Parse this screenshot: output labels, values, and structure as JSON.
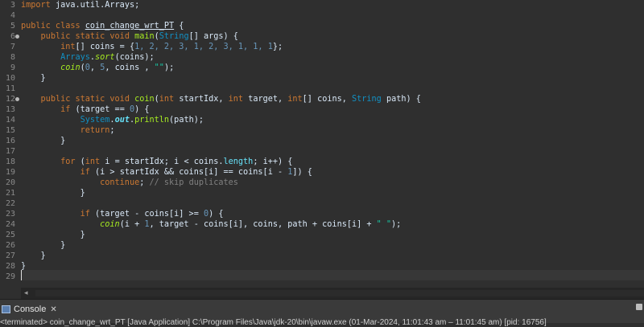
{
  "editor": {
    "line_numbers": [
      "3",
      "4",
      "5",
      "6",
      "7",
      "8",
      "9",
      "10",
      "11",
      "12",
      "13",
      "14",
      "15",
      "16",
      "17",
      "18",
      "19",
      "20",
      "21",
      "22",
      "23",
      "24",
      "25",
      "26",
      "27",
      "28",
      "29"
    ],
    "marked_lines": [
      "6",
      "12"
    ],
    "tokens": {
      "l3_kw": "import",
      "l3_rest": " java.util.Arrays;",
      "l5_kw": "public class",
      "l5_name": "coin_change_wrt_PT",
      "l5_rest": " {",
      "l6_kw": "public static void",
      "l6_m": "main",
      "l6_a": "(",
      "l6_t": "String",
      "l6_rest": "[] args) {",
      "l7_kw": "int",
      "l7_a": "[] coins = {",
      "l7_nums": "1, 2, 2, 3, 1, 2, 3, 1, 1, 1",
      "l7_rest": "};",
      "l8_t": "Arrays",
      "l8_a": ".",
      "l8_m": "sort",
      "l8_rest": "(coins);",
      "l9_m": "coin",
      "l9_a": "(",
      "l9_n1": "0",
      "l9_b": ", ",
      "l9_n2": "5",
      "l9_c": ", coins , ",
      "l9_s": "\"\"",
      "l9_rest": ");",
      "l10": "}",
      "l12_kw": "public static void",
      "l12_m": "coin",
      "l12_a": "(",
      "l12_kw2": "int",
      "l12_b": " startIdx, ",
      "l12_kw3": "int",
      "l12_c": " target, ",
      "l12_kw4": "int",
      "l12_d": "[] coins, ",
      "l12_t": "String",
      "l12_rest": " path) {",
      "l13_kw": "if",
      "l13_a": " (target == ",
      "l13_n": "0",
      "l13_rest": ") {",
      "l14_t": "System",
      "l14_a": ".",
      "l14_f": "out",
      "l14_b": ".",
      "l14_m": "println",
      "l14_rest": "(path);",
      "l15_kw": "return",
      "l15_rest": ";",
      "l16": "}",
      "l18_kw": "for",
      "l18_a": " (",
      "l18_kw2": "int",
      "l18_b": " i = startIdx; i < coins.",
      "l18_f": "length",
      "l18_rest": "; i++) {",
      "l19_kw": "if",
      "l19_a": " (i > startIdx && coins[i] == coins[i - ",
      "l19_n": "1",
      "l19_rest": "]) {",
      "l20_kw": "continue",
      "l20_a": "; ",
      "l20_cmt": "// skip duplicates",
      "l21": "}",
      "l23_kw": "if",
      "l23_a": " (target - coins[i] >= ",
      "l23_n": "0",
      "l23_rest": ") {",
      "l24_m": "coin",
      "l24_a": "(i + ",
      "l24_n": "1",
      "l24_b": ", target - coins[i], coins, path + coins[i] + ",
      "l24_s": "\" \"",
      "l24_rest": ");",
      "l25": "}",
      "l26": "}",
      "l27": "}",
      "l28": "}"
    }
  },
  "console": {
    "tab_label": "Console",
    "close_glyph": "✕",
    "status_text": "<terminated> coin_change_wrt_PT [Java Application] C:\\Program Files\\Java\\jdk-20\\bin\\javaw.exe  (01-Mar-2024, 11:01:43 am – 11:01:45 am) [pid: 16756]"
  },
  "scrollbar": {
    "left_arrow": "◂"
  }
}
